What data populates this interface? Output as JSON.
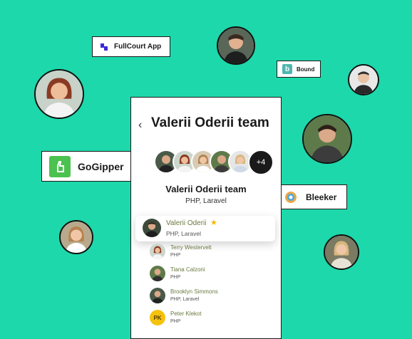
{
  "tags": {
    "fullcourt": "FullCourt App",
    "bound": "Bound",
    "bound_logo": "b",
    "gogipper": "GoGipper",
    "bleeker": "Bleeker"
  },
  "card": {
    "title": "Valerii Oderii team",
    "more_count": "+4",
    "team_name": "Valerii Oderii team",
    "team_skills": "PHP, Laravel",
    "lead": {
      "name": "Valerii Oderii",
      "skills": "PHP, Laravel"
    },
    "members": [
      {
        "name": "Terry Westervelt",
        "skills": "PHP"
      },
      {
        "name": "Tiana Calzoni",
        "skills": "PHP"
      },
      {
        "name": "Brooklyn Simmons",
        "skills": "PHP, Laravel"
      },
      {
        "name": "Peter Klekot",
        "skills": "PHP",
        "initials": "PK"
      }
    ]
  },
  "colors": {
    "background": "#1dd8aa",
    "accent_star": "#f5b800",
    "name_green": "#6b7a40"
  }
}
